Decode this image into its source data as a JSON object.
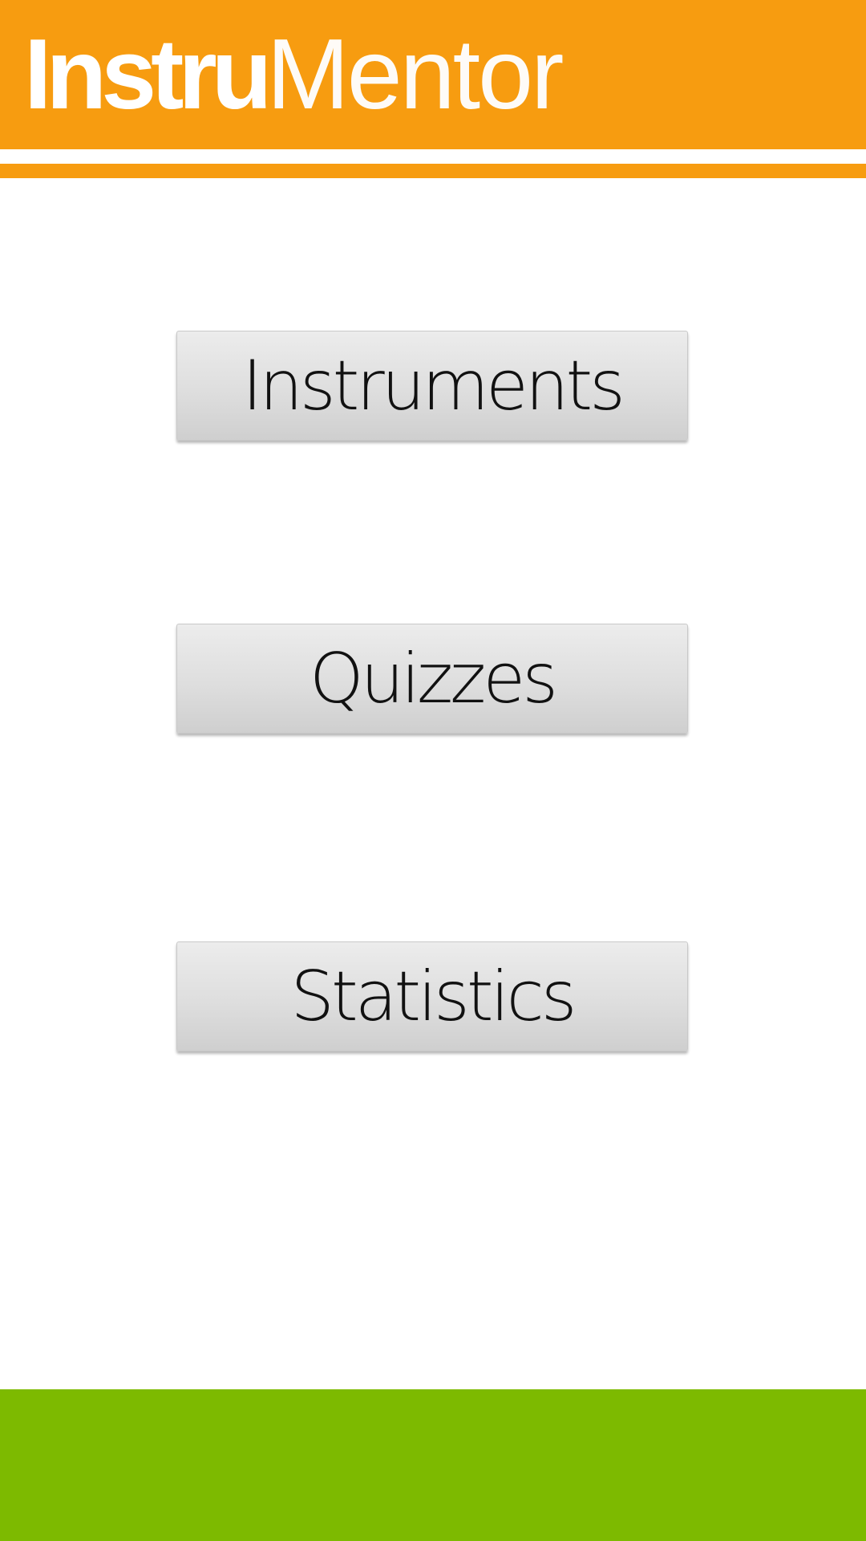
{
  "app": {
    "logo_bold": "Instru",
    "logo_light": "Mentor"
  },
  "menu": {
    "items": [
      {
        "label": "Instruments"
      },
      {
        "label": "Quizzes"
      },
      {
        "label": "Statistics"
      }
    ]
  },
  "colors": {
    "header": "#F79C10",
    "footer": "#7DBA00",
    "button_text": "#111111"
  }
}
